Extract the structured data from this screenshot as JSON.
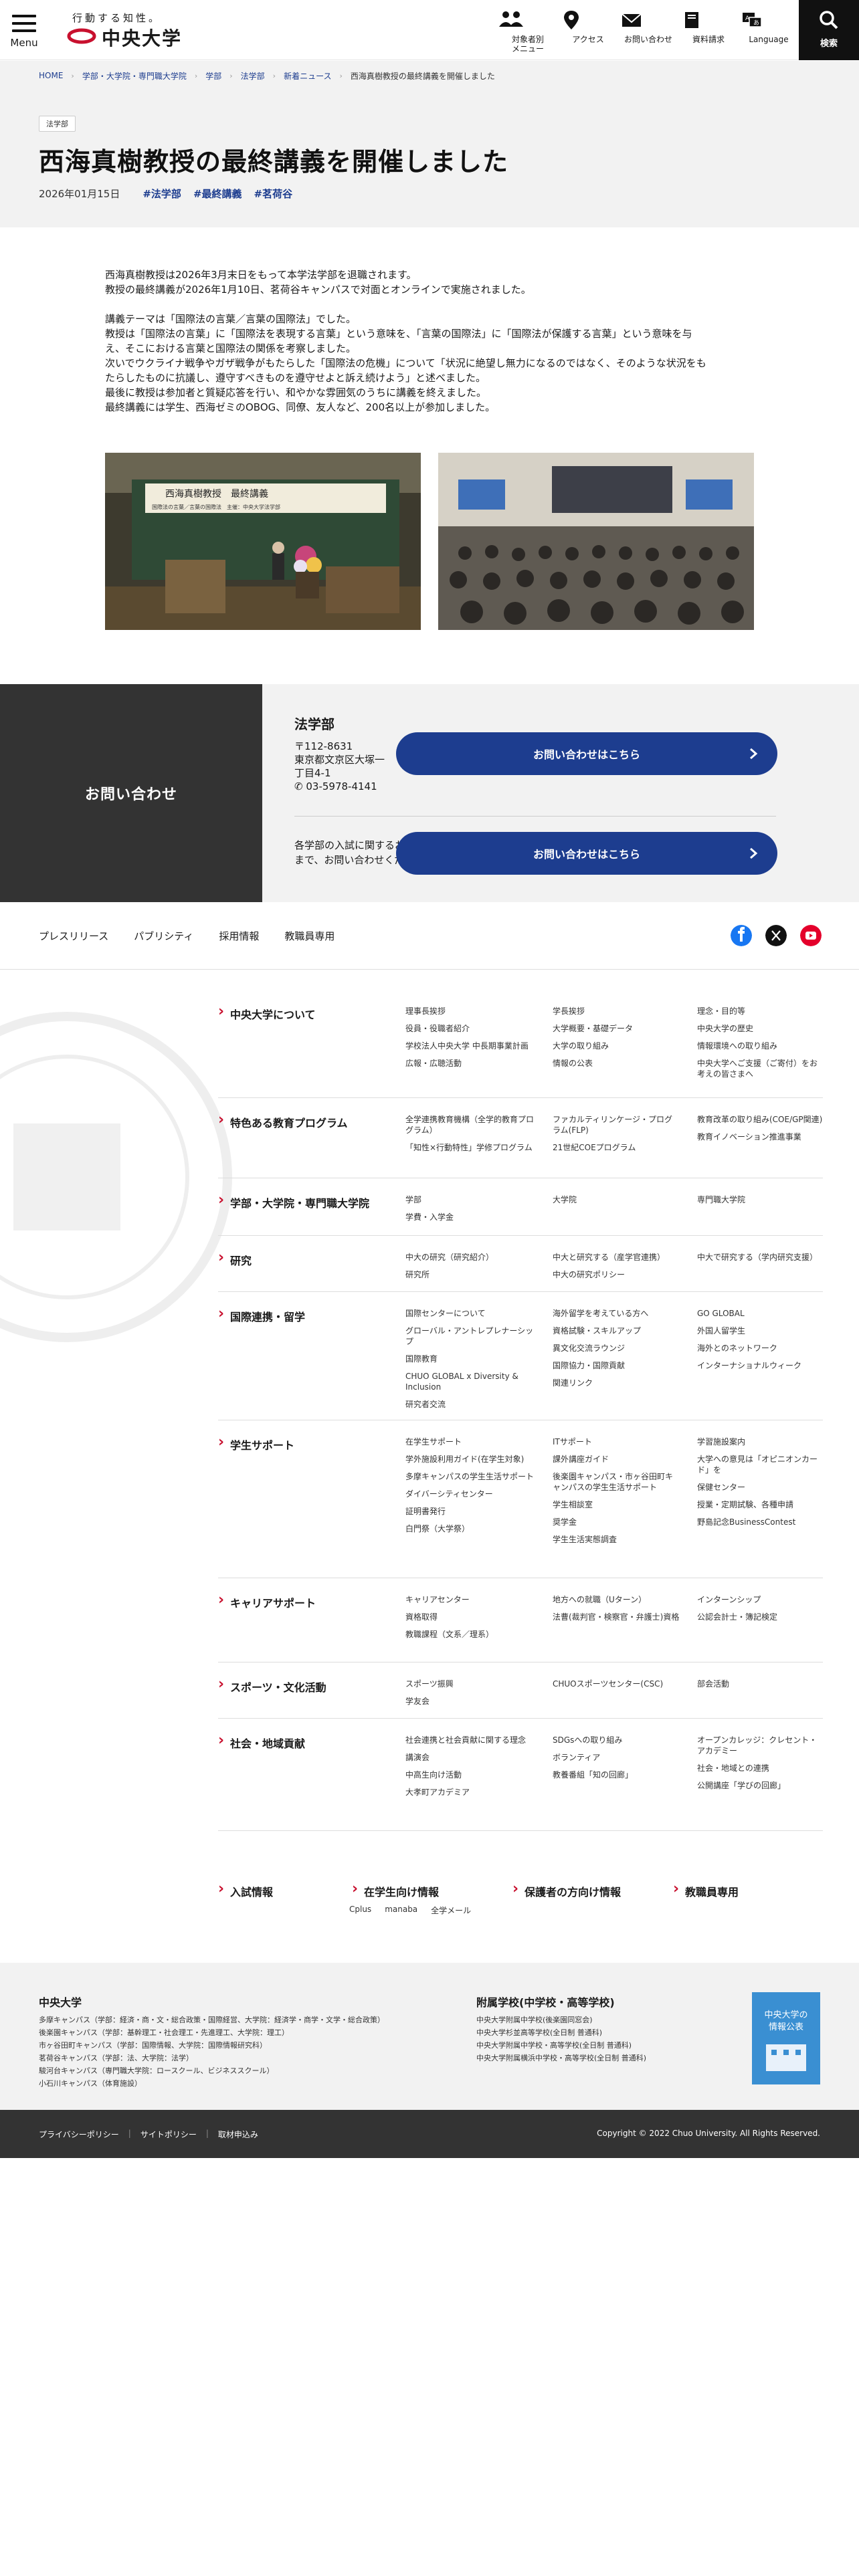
{
  "header": {
    "menu_label": "Menu",
    "logo_tagline": "行動する知性。",
    "logo_name": "中央大学",
    "nav": [
      {
        "label": "対象者別\nメニュー",
        "icon": "people-icon"
      },
      {
        "label": "アクセス",
        "icon": "map-pin-icon"
      },
      {
        "label": "お問い合わせ",
        "icon": "mail-icon"
      },
      {
        "label": "資料請求",
        "icon": "book-icon"
      },
      {
        "label": "Language",
        "icon": "language-icon"
      }
    ],
    "search_label": "検索"
  },
  "breadcrumb": [
    "HOME",
    "学部・大学院・専門職大学院",
    "学部",
    "法学部",
    "新着ニュース",
    "西海真樹教授の最終講義を開催しました"
  ],
  "article": {
    "category": "法学部",
    "title": "西海真樹教授の最終講義を開催しました",
    "date": "2026年01月15日",
    "tags": [
      "#法学部",
      "#最終講義",
      "#茗荷谷"
    ],
    "paragraphs": [
      "西海真樹教授は2026年3月末日をもって本学法学部を退職されます。",
      "教授の最終講義が2026年1月10日、茗荷谷キャンパスで対面とオンラインで実施されました。",
      "",
      "講義テーマは「国際法の言葉／言葉の国際法」でした。",
      "教授は「国際法の言葉」に「国際法を表現する言葉」という意味を、「言葉の国際法」に「国際法が保護する言葉」という意味を与",
      "え、そこにおける言葉と国際法の関係を考察しました。",
      "次いでウクライナ戦争やガザ戦争がもたらした「国際法の危機」について「状況に絶望し無力になるのではなく、そのような状況をも",
      "たらしたものに抗議し、遵守すべきものを遵守せよと訴え続けよう」と述べました。",
      "最後に教授は参加者と質疑応答を行い、和やかな雰囲気のうちに講義を終えました。",
      "最終講義には学生、西海ゼミのOBOG、同僚、友人など、200名以上が参加しました。"
    ],
    "banner_text_1": "西海真樹教授　最終講義",
    "banner_text_2": "国際法の言葉／言葉の国際法　主催：中央大学法学部"
  },
  "contact": {
    "heading": "お問い合わせ",
    "dept": "法学部",
    "address": [
      "〒112-8631",
      "東京都文京区大塚一",
      "丁目4-1"
    ],
    "phone": "03-5978-4141",
    "button_label": "お問い合わせはこちら",
    "note": "各学部の入試に関するお問い合わせは入試課まで、お問い合わせください。",
    "button2_label": "お問い合わせはこちら"
  },
  "utility_links": [
    "プレスリリース",
    "パブリシティ",
    "採用情報",
    "教職員専用"
  ],
  "sitemap": [
    {
      "title": "中央大学について",
      "cols": [
        [
          "理事長挨拶",
          "役員・役職者紹介",
          "学校法人中央大学 中長期事業計画",
          "広報・広聴活動"
        ],
        [
          "学長挨拶",
          "大学概要・基礎データ",
          "大学の取り組み",
          "情報の公表"
        ],
        [
          "理念・目的等",
          "中央大学の歴史",
          "情報環境への取り組み",
          "中央大学へご支援（ご寄付）をお考えの皆さまへ"
        ]
      ]
    },
    {
      "title": "特色ある教育プログラム",
      "cols": [
        [
          "全学連携教育機構（全学的教育プログラム）",
          "「知性×行動特性」学修プログラム"
        ],
        [
          "ファカルティリンケージ・プログラム(FLP)",
          "21世紀COEプログラム"
        ],
        [
          "教育改革の取り組み(COE/GP関連)",
          "教育イノベーション推進事業"
        ]
      ]
    },
    {
      "title": "学部・大学院・専門職大学院",
      "cols": [
        [
          "学部",
          "学費・入学金"
        ],
        [
          "大学院"
        ],
        [
          "専門職大学院"
        ]
      ]
    },
    {
      "title": "研究",
      "cols": [
        [
          "中大の研究（研究紹介）",
          "研究所"
        ],
        [
          "中大と研究する（産学官連携）",
          "中大の研究ポリシー"
        ],
        [
          "中大で研究する（学内研究支援）"
        ]
      ]
    },
    {
      "title": "国際連携・留学",
      "cols": [
        [
          "国際センターについて",
          "グローバル・アントレプレナーシップ",
          "国際教育",
          "CHUO GLOBAL x Diversity & Inclusion",
          "研究者交流"
        ],
        [
          "海外留学を考えている方へ",
          "資格試験・スキルアップ",
          "異文化交流ラウンジ",
          "国際協力・国際貢献",
          "関連リンク"
        ],
        [
          "GO GLOBAL",
          "外国人留学生",
          "海外とのネットワーク",
          "インターナショナルウィーク"
        ]
      ]
    },
    {
      "title": "学生サポート",
      "cols": [
        [
          "在学生サポート",
          "学外施設利用ガイド(在学生対象)",
          "多摩キャンパスの学生生活サポート",
          "ダイバーシティセンター",
          "証明書発行",
          "白門祭（大学祭）"
        ],
        [
          "ITサポート",
          "課外講座ガイド",
          "後楽園キャンパス・市ヶ谷田町キャンパスの学生生活サポート",
          "学生相談室",
          "奨学金",
          "学生生活実態調査"
        ],
        [
          "学習施設案内",
          "大学への意見は「オピニオンカード」を",
          "保健センター",
          "授業・定期試験、各種申請",
          "野島記念BusinessContest"
        ]
      ]
    },
    {
      "title": "キャリアサポート",
      "cols": [
        [
          "キャリアセンター",
          "資格取得",
          "教職課程（文系／理系）"
        ],
        [
          "地方への就職（Uターン）",
          "法曹(裁判官・検察官・弁護士)資格"
        ],
        [
          "インターンシップ",
          "公認会計士・簿記検定"
        ]
      ]
    },
    {
      "title": "スポーツ・文化活動",
      "cols": [
        [
          "スポーツ振興",
          "学友会"
        ],
        [
          "CHUOスポーツセンター(CSC)"
        ],
        [
          "部会活動"
        ]
      ]
    },
    {
      "title": "社会・地域貢献",
      "cols": [
        [
          "社会連携と社会貢献に関する理念",
          "講演会",
          "中高生向け活動",
          "大孝町アカデミア"
        ],
        [
          "SDGsへの取り組み",
          "ボランティア",
          "教養番組「知の回廊」"
        ],
        [
          "オープンカレッジ：クレセント・アカデミー",
          "社会・地域との連携",
          "公開講座「学びの回廊」"
        ]
      ]
    }
  ],
  "bottom_cats": [
    {
      "title": "入試情報",
      "subs": []
    },
    {
      "title": "在学生向け情報",
      "subs": [
        "Cplus",
        "manaba",
        "全学メール"
      ]
    },
    {
      "title": "保護者の方向け情報",
      "subs": []
    },
    {
      "title": "教職員専用",
      "subs": []
    }
  ],
  "footer": {
    "univ_title": "中央大学",
    "univ_campuses": [
      "多摩キャンパス（学部：経済・商・文・総合政策・国際経営、大学院：経済学・商学・文学・総合政策）",
      "後楽園キャンパス（学部：基幹理工・社会理工・先進理工、大学院：理工）",
      "市ヶ谷田町キャンパス（学部：国際情報、大学院：国際情報研究科）",
      "茗荷谷キャンパス（学部：法、大学院：法学）",
      "駿河台キャンパス（専門職大学院：ロースクール、ビジネススクール）",
      "小石川キャンパス（体育施設）"
    ],
    "school_title": "附属学校(中学校・高等学校)",
    "schools": [
      "中央大学附属中学校(後楽園同窓会)",
      "中央大学杉並高等学校(全日制 普通科)",
      "中央大学附属中学校・高等学校(全日制 普通科)",
      "中央大学附属横浜中学校・高等学校(全日制 普通科)"
    ],
    "banner_text": "中央大学の情報公表",
    "bottom_links": [
      "プライバシーポリシー",
      "サイトポリシー",
      "取材申込み"
    ],
    "copyright": "Copyright © 2022 Chuo University. All Rights Reserved."
  },
  "colors": {
    "accent": "#1d3d8f",
    "brand_red": "#c8102e",
    "dark": "#333333",
    "light_bg": "#f2f2f2"
  }
}
